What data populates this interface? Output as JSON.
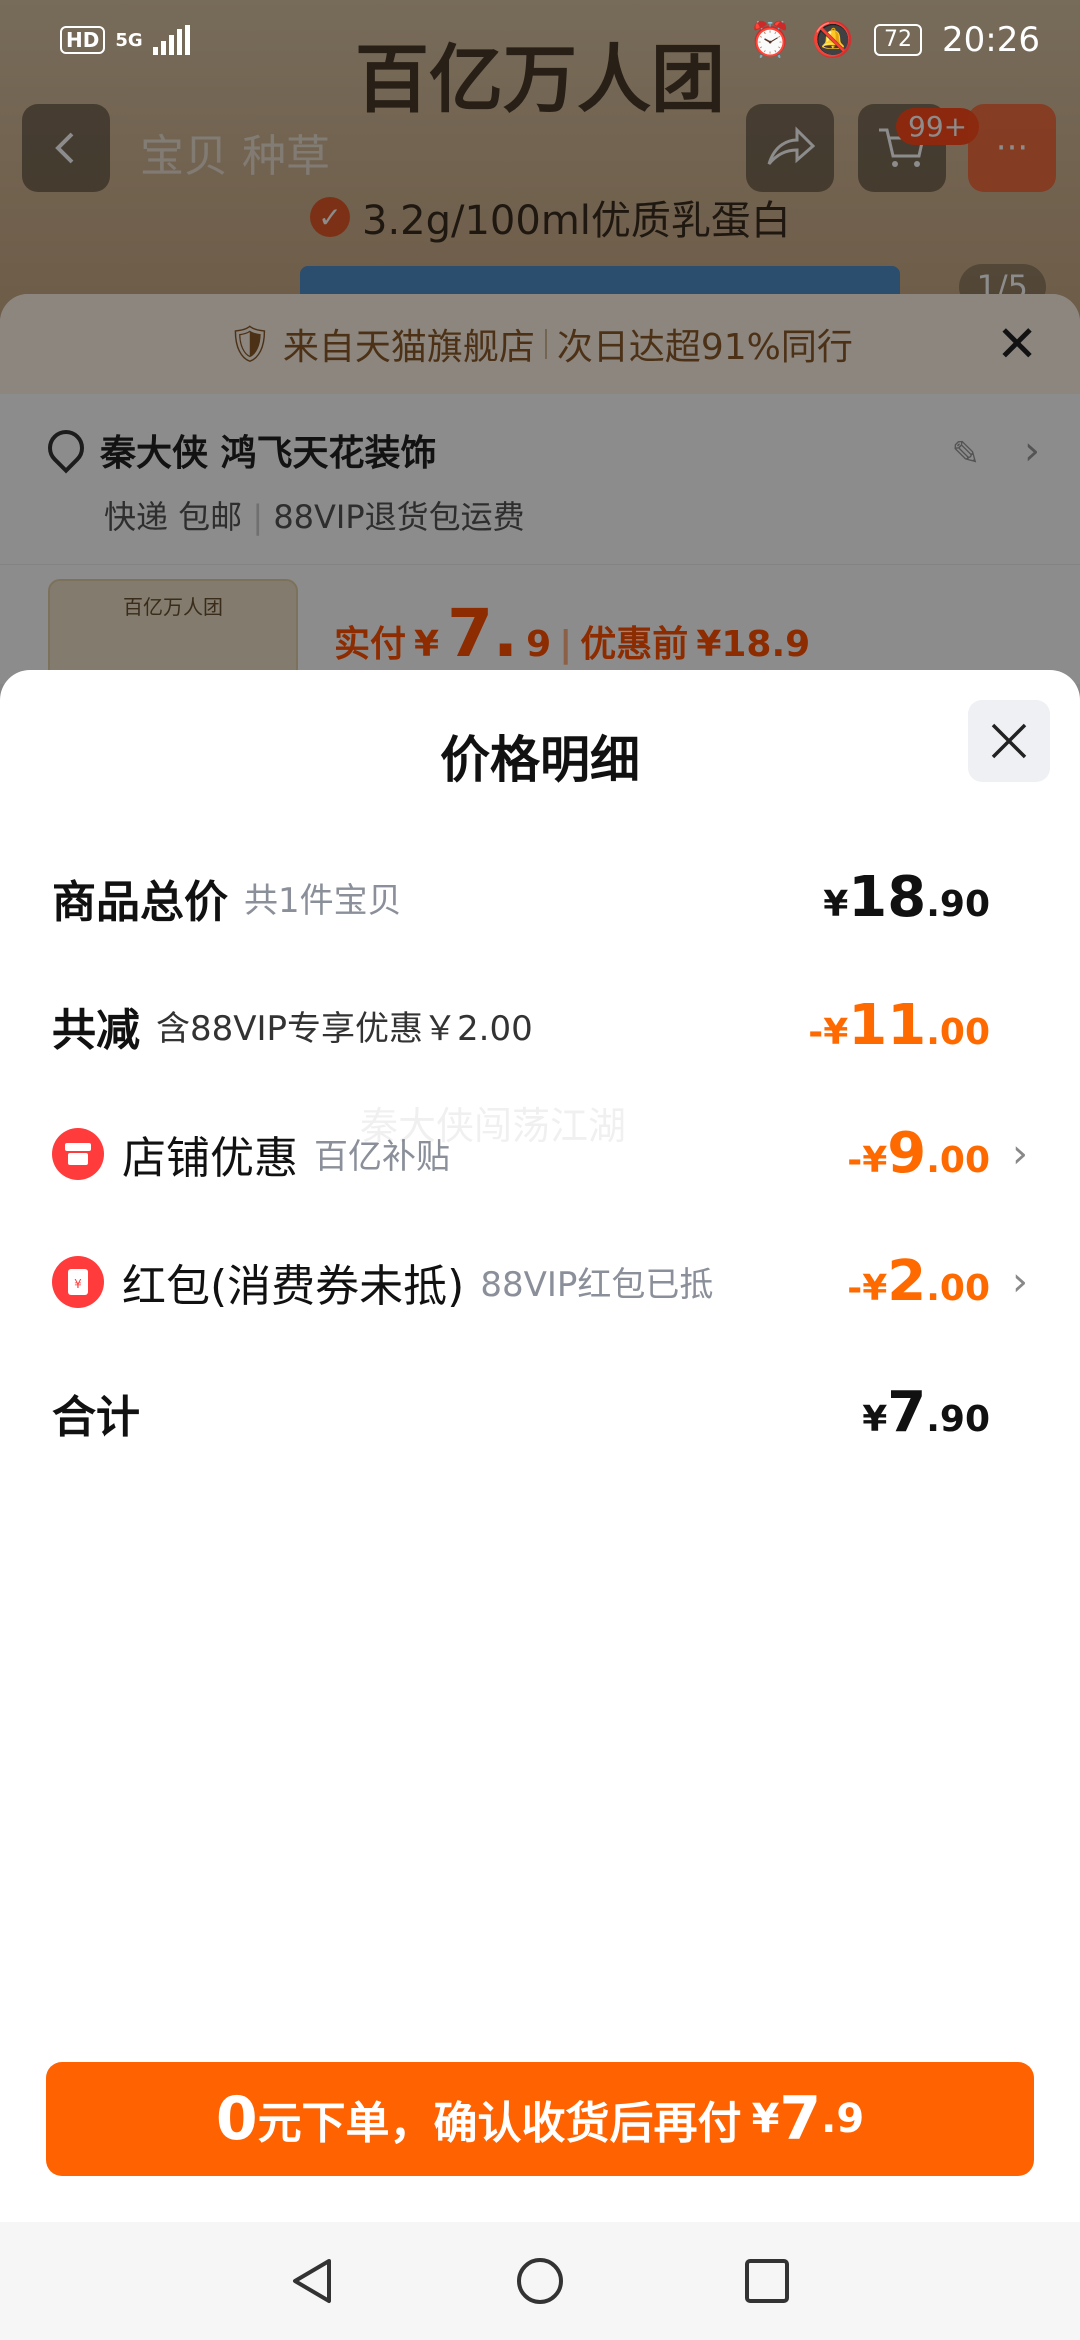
{
  "status_bar": {
    "hd": "HD",
    "network": "5G",
    "battery": "72",
    "time": "20:26"
  },
  "background_page": {
    "hero_title": "百亿万人团",
    "hero_subtitle": "3.2g/100ml优质乳蛋白",
    "image_counter": "1/5",
    "nav_tabs": "宝贝 种草",
    "cart_badge": "99+"
  },
  "order_sheet": {
    "banner_text": "来自天猫旗舰店",
    "banner_text2": "次日达超91%同行",
    "address_name": "秦大侠 鸿飞天花装饰",
    "delivery": "快递 包邮",
    "vip_return": "88VIP退货包运费",
    "product_thumb_title": "百亿万人团",
    "pay_label": "实付",
    "pay_currency": "¥",
    "pay_int": "7.",
    "pay_dec": "9",
    "before_label": "优惠前",
    "before_price": "¥18.9"
  },
  "price_detail": {
    "title": "价格明细",
    "watermark": "秦大侠闯荡江湖",
    "rows": [
      {
        "label": "商品总价",
        "sub": "共1件宝贝",
        "currency": "¥",
        "int": "18",
        "dec": ".90"
      },
      {
        "label": "共减",
        "sub": "含88VIP专享优惠￥2.00",
        "currency": "-¥",
        "int": "11",
        "dec": ".00"
      },
      {
        "label": "店铺优惠",
        "sub": "百亿补贴",
        "currency": "-¥",
        "int": "9",
        "dec": ".00"
      },
      {
        "label": "红包(消费券未抵)",
        "sub": "88VIP红包已抵",
        "currency": "-¥",
        "int": "2",
        "dec": ".00"
      },
      {
        "label": "合计",
        "sub": "",
        "currency": "¥",
        "int": "7",
        "dec": ".90"
      }
    ]
  },
  "cta": {
    "zero": "0",
    "text": "元下单，确认收货后再付",
    "currency": "¥",
    "int": "7",
    "dec": ".9"
  },
  "colors": {
    "accent": "#ff6200",
    "discount": "#ff6a00",
    "icon_red": "#ff3b3b"
  }
}
